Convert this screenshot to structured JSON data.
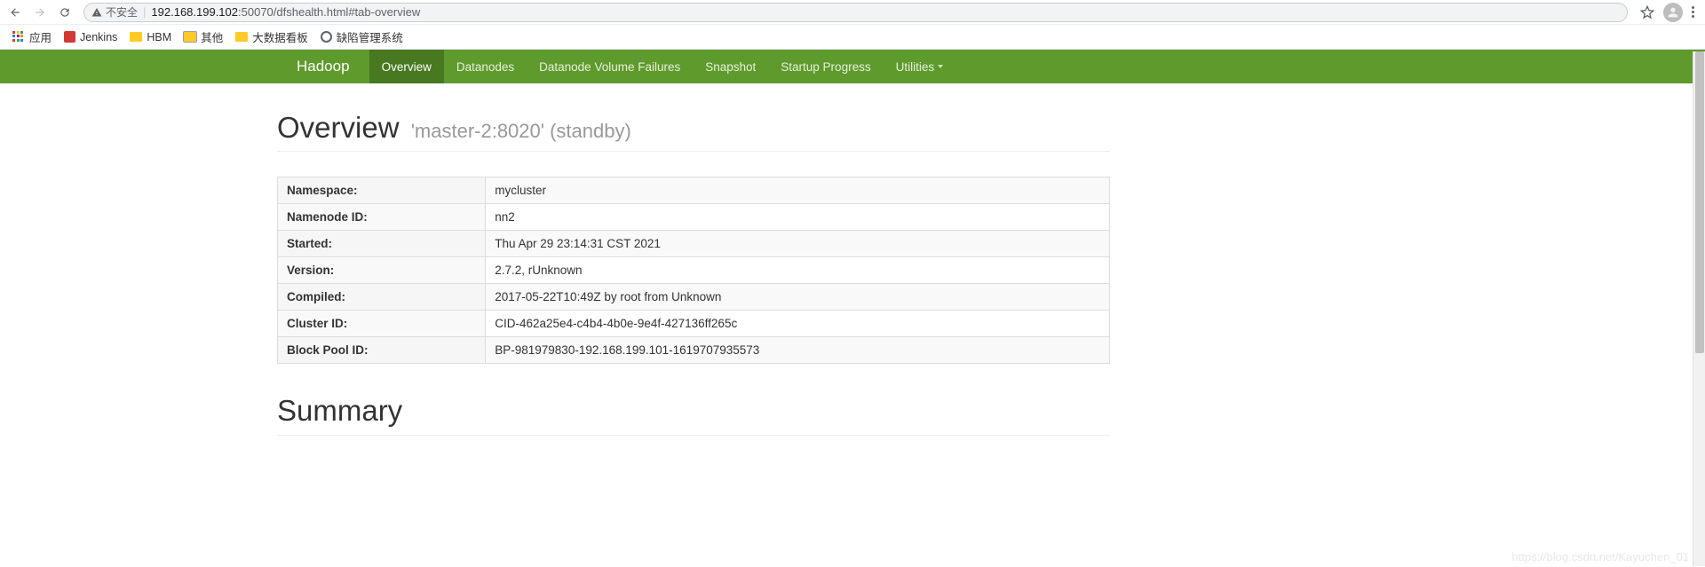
{
  "browser": {
    "security_label": "不安全",
    "url_host": "192.168.199.102",
    "url_port_path": ":50070/dfshealth.html#tab-overview"
  },
  "bookmarks": {
    "apps": "应用",
    "items": [
      "Jenkins",
      "HBM",
      "其他",
      "大数据看板",
      "缺陷管理系统"
    ]
  },
  "nav": {
    "brand": "Hadoop",
    "tabs": [
      "Overview",
      "Datanodes",
      "Datanode Volume Failures",
      "Snapshot",
      "Startup Progress",
      "Utilities"
    ],
    "active_index": 0
  },
  "overview": {
    "title": "Overview",
    "subtitle": "'master-2:8020' (standby)",
    "rows": [
      {
        "label": "Namespace:",
        "value": "mycluster"
      },
      {
        "label": "Namenode ID:",
        "value": "nn2"
      },
      {
        "label": "Started:",
        "value": "Thu Apr 29 23:14:31 CST 2021"
      },
      {
        "label": "Version:",
        "value": "2.7.2, rUnknown"
      },
      {
        "label": "Compiled:",
        "value": "2017-05-22T10:49Z by root from Unknown"
      },
      {
        "label": "Cluster ID:",
        "value": "CID-462a25e4-c4b4-4b0e-9e4f-427136ff265c"
      },
      {
        "label": "Block Pool ID:",
        "value": "BP-981979830-192.168.199.101-1619707935573"
      }
    ]
  },
  "summary": {
    "title": "Summary"
  },
  "watermark": "https://blog.csdn.net/Kayuchen_01"
}
